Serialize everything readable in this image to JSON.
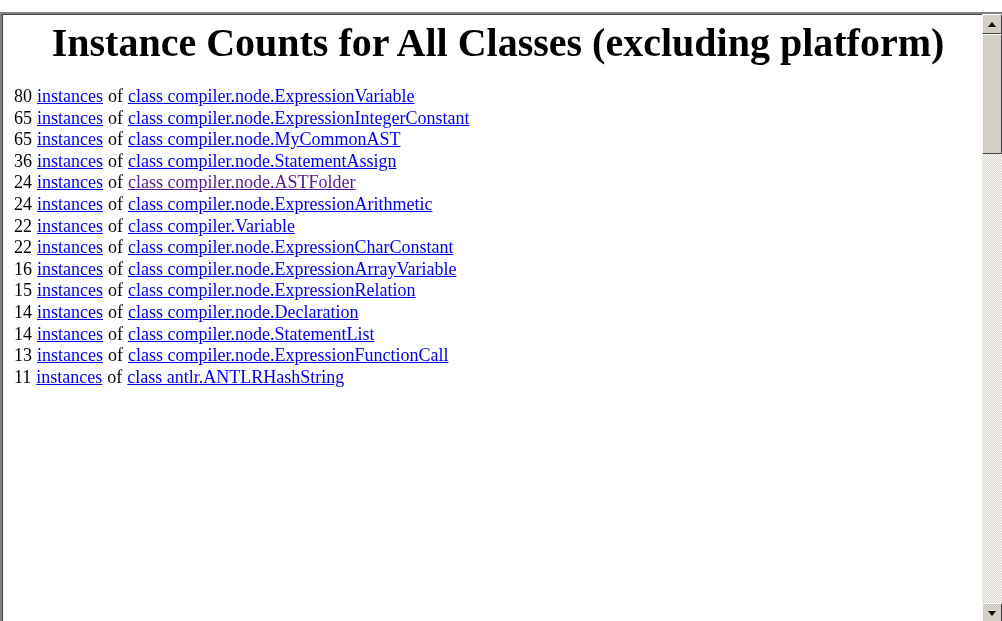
{
  "heading": "Instance Counts for All Classes (excluding platform)",
  "rows": [
    {
      "count": "80",
      "link": "instances",
      "connector": "of",
      "class_name": "class compiler.node.ExpressionVariable",
      "visited": false
    },
    {
      "count": "65",
      "link": "instances",
      "connector": "of",
      "class_name": "class compiler.node.ExpressionIntegerConstant",
      "visited": false
    },
    {
      "count": "65",
      "link": "instances",
      "connector": "of",
      "class_name": "class compiler.node.MyCommonAST",
      "visited": false
    },
    {
      "count": "36",
      "link": "instances",
      "connector": "of",
      "class_name": "class compiler.node.StatementAssign",
      "visited": false
    },
    {
      "count": "24",
      "link": "instances",
      "connector": "of",
      "class_name": "class compiler.node.ASTFolder",
      "visited": true
    },
    {
      "count": "24",
      "link": "instances",
      "connector": "of",
      "class_name": "class compiler.node.ExpressionArithmetic",
      "visited": false
    },
    {
      "count": "22",
      "link": "instances",
      "connector": "of",
      "class_name": "class compiler.Variable",
      "visited": false
    },
    {
      "count": "22",
      "link": "instances",
      "connector": "of",
      "class_name": "class compiler.node.ExpressionCharConstant",
      "visited": false
    },
    {
      "count": "16",
      "link": "instances",
      "connector": "of",
      "class_name": "class compiler.node.ExpressionArrayVariable",
      "visited": false
    },
    {
      "count": "15",
      "link": "instances",
      "connector": "of",
      "class_name": "class compiler.node.ExpressionRelation",
      "visited": false
    },
    {
      "count": "14",
      "link": "instances",
      "connector": "of",
      "class_name": "class compiler.node.Declaration",
      "visited": false
    },
    {
      "count": "14",
      "link": "instances",
      "connector": "of",
      "class_name": "class compiler.node.StatementList",
      "visited": false
    },
    {
      "count": "13",
      "link": "instances",
      "connector": "of",
      "class_name": "class compiler.node.ExpressionFunctionCall",
      "visited": false
    },
    {
      "count": "11",
      "link": "instances",
      "connector": "of",
      "class_name": "class antlr.ANTLRHashString",
      "visited": false
    }
  ]
}
